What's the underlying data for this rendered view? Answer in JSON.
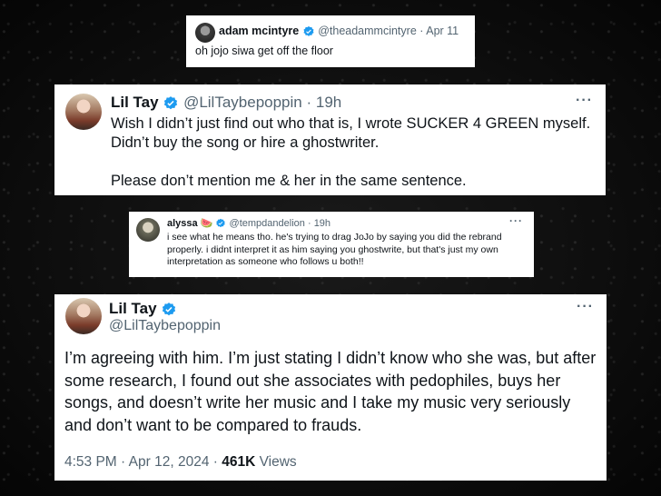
{
  "colors": {
    "verified": "#1d9bf0",
    "muted": "#536471",
    "text": "#0f1419"
  },
  "tweet1": {
    "name": "adam mcintyre",
    "handle": "@theadammcintyre",
    "sep": "·",
    "time": "Apr 11",
    "text": "oh jojo siwa get off the floor"
  },
  "tweet2": {
    "name": "Lil Tay",
    "handle": "@LilTaybepoppin",
    "sep": "·",
    "time": "19h",
    "more": "···",
    "line1": "Wish I didn’t just find out who that is, I wrote SUCKER 4 GREEN myself.",
    "line2": "Didn’t buy the song or hire a ghostwriter.",
    "line3": "Please don’t mention me & her in the same sentence."
  },
  "tweet3": {
    "name": "alyssa",
    "emoji": "🍉",
    "handle": "@tempdandelion",
    "sep": "·",
    "time": "19h",
    "more": "···",
    "text": "i see what he means tho. he's trying to drag JoJo by saying you did the rebrand properly. i didnt interpret it as him saying you ghostwrite, but that's just my own interpretation as someone who follows u both!!"
  },
  "tweet4": {
    "name": "Lil Tay",
    "handle": "@LilTaybepoppin",
    "more": "···",
    "text": "I’m agreeing with him. I’m just stating I didn’t know who she was, but after some research, I found out she associates with pedophiles, buys her songs, and doesn’t write her music and I take my music very seriously and don’t want to be compared to frauds.",
    "time": "4:53 PM",
    "sep": "·",
    "date": "Apr 12, 2024",
    "views_count": "461K",
    "views_label": "Views"
  }
}
